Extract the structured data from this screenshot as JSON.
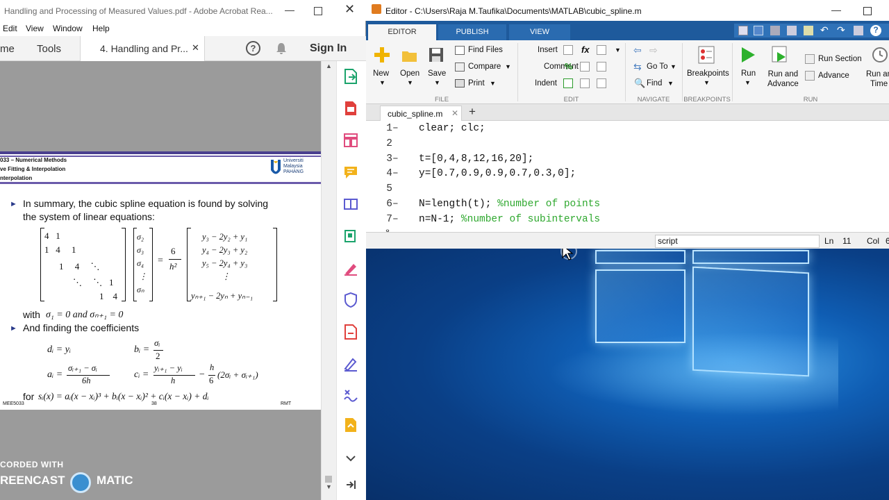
{
  "acrobat": {
    "title": "Handling and Processing of Measured Values.pdf - Adobe Acrobat Rea...",
    "menu": [
      "Edit",
      "View",
      "Window",
      "Help"
    ],
    "home_tab": "me",
    "tools_tab": "Tools",
    "doc_tab": "4. Handling and Pr...",
    "sign_in": "Sign In",
    "page_header": {
      "course": "033 – Numerical Methods",
      "topic": "ve Fitting & Interpolation",
      "sub": "nterpolation",
      "logo": "Universiti Malaysia PAHANG"
    },
    "bullet1": "In summary, the cubic spline equation is found by solving",
    "bullet1b": "the system of linear equations:",
    "bullet2": "And finding the coefficients",
    "with_text": "with",
    "for_text": "for",
    "footer_left": "MEE5033",
    "footer_mid": "38",
    "footer_right": "RMT",
    "watermark1": "CORDED WITH",
    "watermark2": "REENCAST",
    "watermark3": "MATIC"
  },
  "matlab": {
    "title": "Editor - C:\\Users\\Raja M.Taufika\\Documents\\MATLAB\\cubic_spline.m",
    "tabs": [
      "EDITOR",
      "PUBLISH",
      "VIEW"
    ],
    "ribbon": {
      "new": "New",
      "open": "Open",
      "save": "Save",
      "find_files": "Find Files",
      "compare": "Compare",
      "print": "Print",
      "insert": "Insert",
      "comment": "Comment",
      "indent": "Indent",
      "goto": "Go To",
      "find": "Find",
      "breakpoints": "Breakpoints",
      "run": "Run",
      "run_advance_1": "Run and",
      "run_advance_2": "Advance",
      "run_section": "Run Section",
      "advance": "Advance",
      "run_time_1": "Run an",
      "run_time_2": "Time"
    },
    "groups": [
      "FILE",
      "EDIT",
      "NAVIGATE",
      "BREAKPOINTS",
      "RUN"
    ],
    "file_tab": "cubic_spline.m",
    "code": [
      {
        "n": "1",
        "code": "clear; clc;",
        "comment": ""
      },
      {
        "n": "2",
        "code": "",
        "comment": ""
      },
      {
        "n": "3",
        "code": "t=[0,4,8,12,16,20];",
        "comment": ""
      },
      {
        "n": "4",
        "code": "y=[0.7,0.9,0.9,0.7,0.3,0];",
        "comment": ""
      },
      {
        "n": "5",
        "code": "",
        "comment": ""
      },
      {
        "n": "6",
        "code": "N=length(t); ",
        "comment": "%number of points"
      },
      {
        "n": "7",
        "code": "n=N-1; ",
        "comment": "%number of subintervals"
      }
    ],
    "status": {
      "type": "script",
      "ln_label": "Ln",
      "ln": "11",
      "col_label": "Col",
      "col": "6"
    }
  }
}
